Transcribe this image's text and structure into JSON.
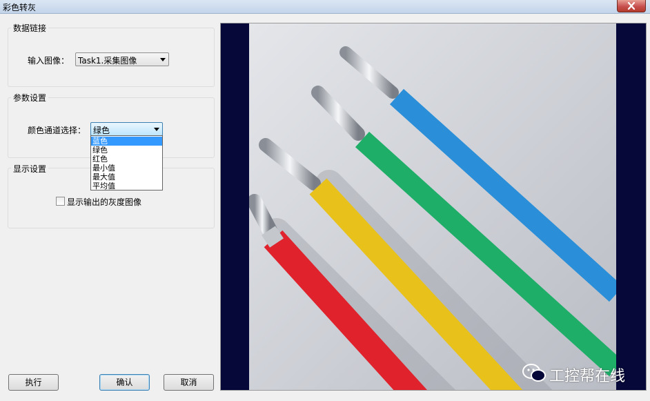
{
  "window": {
    "title": "彩色转灰"
  },
  "data_link": {
    "group_title": "数据链接",
    "input_label": "输入图像：",
    "input_value": "Task1.采集图像"
  },
  "params": {
    "group_title": "参数设置",
    "channel_label": "颜色通道选择：",
    "channel_value": "绿色",
    "options": [
      "蓝色",
      "绿色",
      "红色",
      "最小值",
      "最大值",
      "平均值"
    ],
    "highlighted_index": 0
  },
  "display": {
    "group_title": "显示设置",
    "checkbox_label": "显示输出的灰度图像",
    "checked": false
  },
  "buttons": {
    "execute": "执行",
    "confirm": "确认",
    "cancel": "取消"
  },
  "watermark": {
    "text": "工控帮在线"
  },
  "colors": {
    "image_background": "#050838",
    "wire_red": "#e0222c",
    "wire_yellow": "#e8c21a",
    "wire_green": "#1eae68",
    "wire_blue": "#2a8fd8",
    "highlight": "#3399ff"
  }
}
